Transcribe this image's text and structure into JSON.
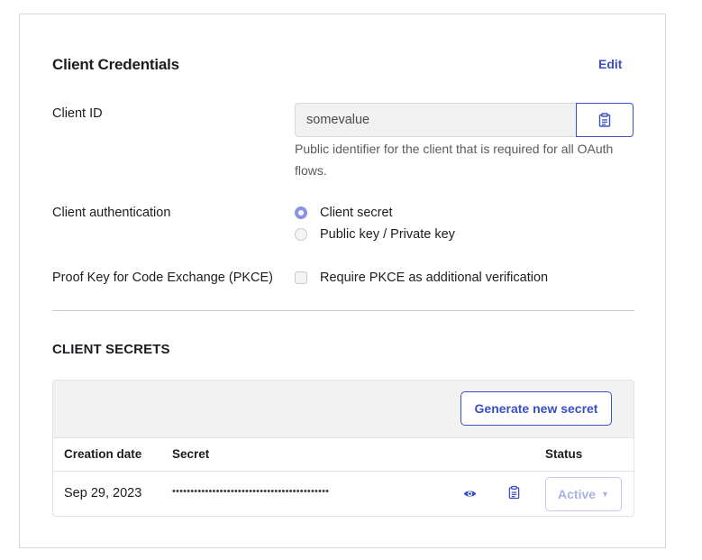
{
  "header": {
    "title": "Client Credentials",
    "edit_label": "Edit"
  },
  "client_id": {
    "label": "Client ID",
    "value": "somevalue",
    "helper": "Public identifier for the client that is required for all OAuth flows.",
    "copy_icon": "clipboard-icon"
  },
  "client_auth": {
    "label": "Client authentication",
    "options": [
      {
        "label": "Client secret",
        "selected": true
      },
      {
        "label": "Public key / Private key",
        "selected": false
      }
    ]
  },
  "pkce": {
    "label": "Proof Key for Code Exchange (PKCE)",
    "checkbox_label": "Require PKCE as additional verification",
    "checked": false
  },
  "secrets": {
    "section_title": "CLIENT SECRETS",
    "generate_label": "Generate new secret",
    "columns": [
      "Creation date",
      "Secret",
      "Status"
    ],
    "rows": [
      {
        "creation_date": "Sep 29, 2023",
        "secret_masked": "•••••••••••••••••••••••••••••••••••••••••••",
        "status": "Active"
      }
    ]
  },
  "colors": {
    "accent": "#3a4ec6",
    "radio_checked": "#8a93e6"
  }
}
